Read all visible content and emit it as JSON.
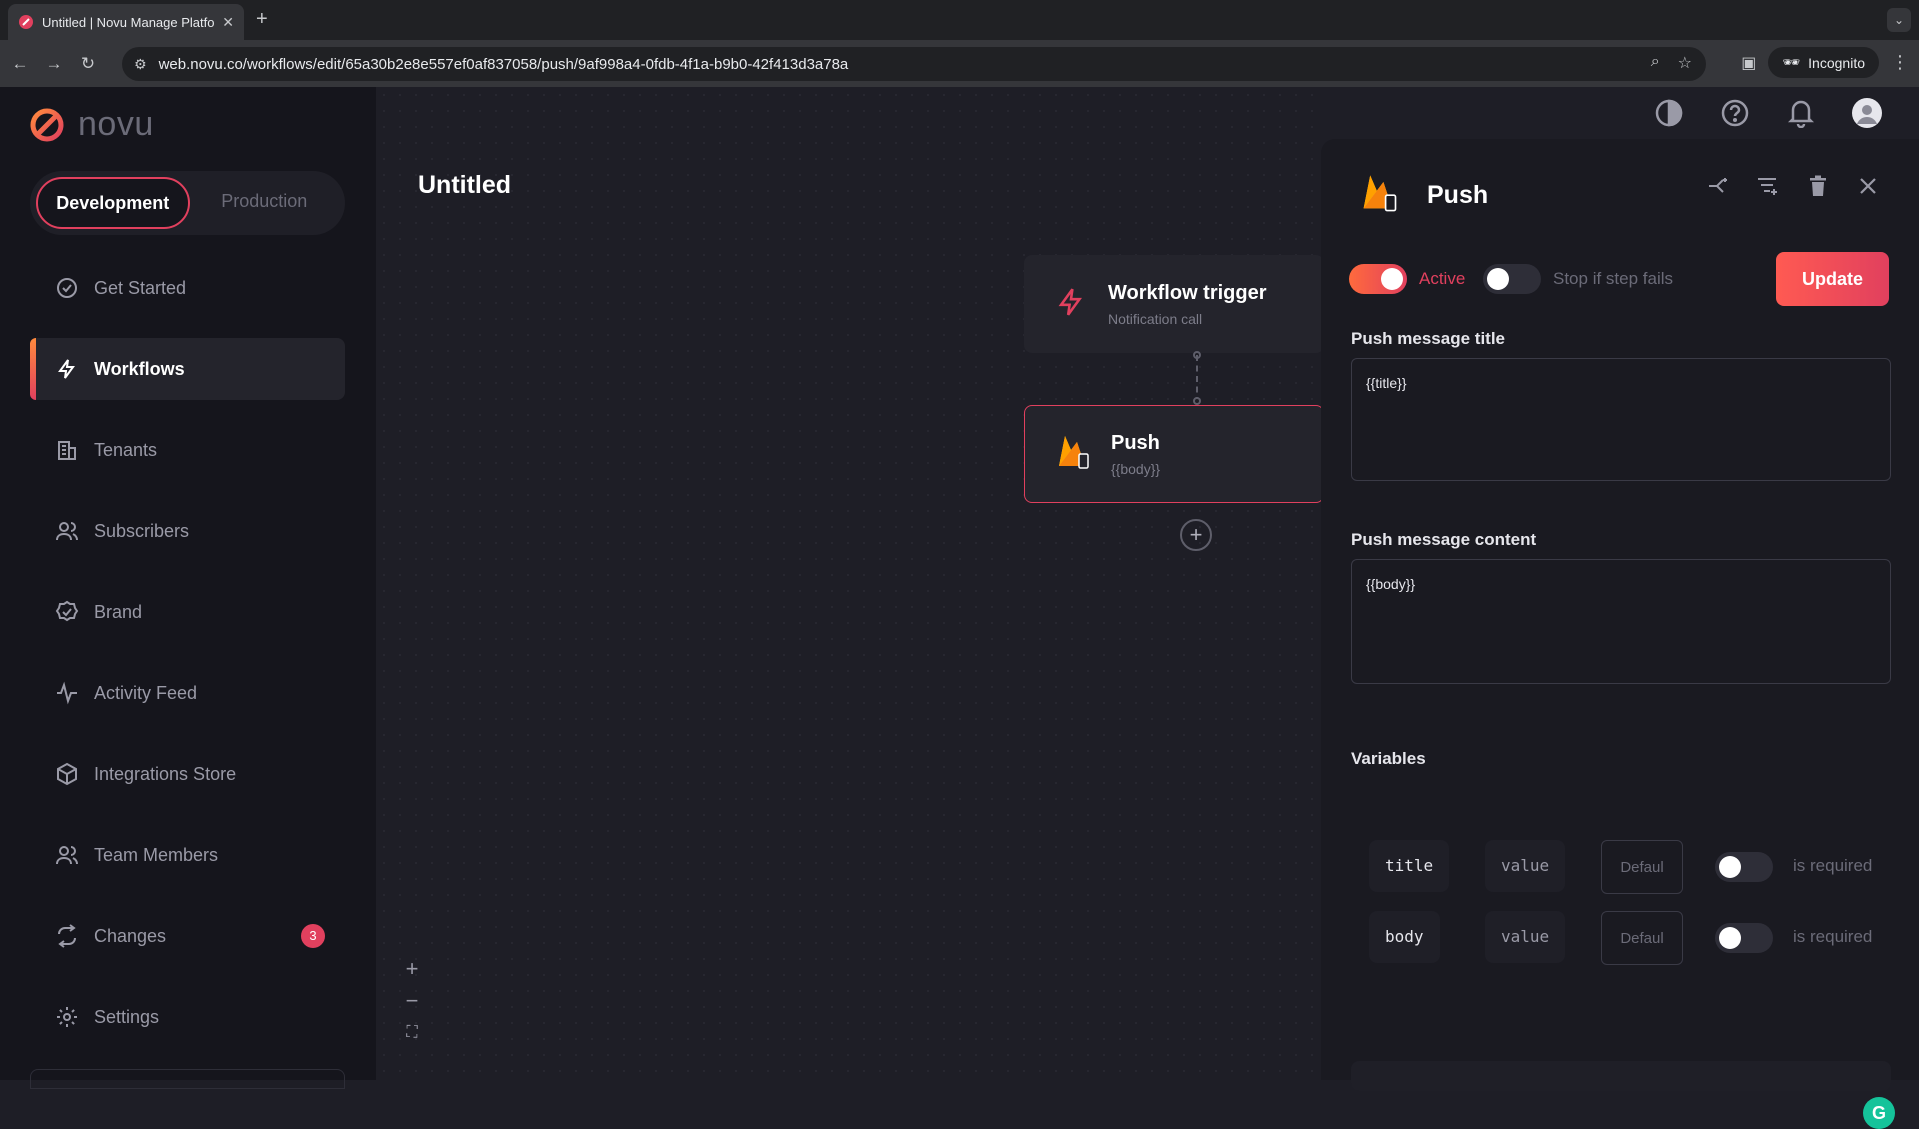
{
  "browser": {
    "tab_title": "Untitled | Novu Manage Platfo",
    "url": "web.novu.co/workflows/edit/65a30b2e8e557ef0af837058/push/9af998a4-0fdb-4f1a-b9b0-42f413d3a78a",
    "incognito_label": "Incognito"
  },
  "app": {
    "logo_text": "novu",
    "env": {
      "development": "Development",
      "production": "Production"
    },
    "nav": [
      {
        "label": "Get Started",
        "icon": "check-circle-icon"
      },
      {
        "label": "Workflows",
        "icon": "bolt-icon"
      },
      {
        "label": "Tenants",
        "icon": "building-icon"
      },
      {
        "label": "Subscribers",
        "icon": "users-icon"
      },
      {
        "label": "Brand",
        "icon": "badge-check-icon"
      },
      {
        "label": "Activity Feed",
        "icon": "activity-icon"
      },
      {
        "label": "Integrations Store",
        "icon": "box-icon"
      },
      {
        "label": "Team Members",
        "icon": "users-icon"
      },
      {
        "label": "Changes",
        "icon": "repeat-icon",
        "badge": "3"
      },
      {
        "label": "Settings",
        "icon": "gear-icon"
      }
    ]
  },
  "workflow": {
    "title": "Untitled",
    "trigger": {
      "title": "Workflow trigger",
      "subtitle": "Notification call"
    },
    "step": {
      "title": "Push",
      "subtitle": "{{body}}"
    }
  },
  "panel": {
    "title": "Push",
    "active_label": "Active",
    "active_on": true,
    "stop_label": "Stop if step fails",
    "stop_on": false,
    "update_label": "Update",
    "title_field": {
      "label": "Push message title",
      "value": "{{title}}"
    },
    "content_field": {
      "label": "Push message content",
      "value": "{{body}}"
    },
    "variables_label": "Variables",
    "variables": [
      {
        "name": "title",
        "type": "value",
        "default_placeholder": "Defaul",
        "required_label": "is required"
      },
      {
        "name": "body",
        "type": "value",
        "default_placeholder": "Defaul",
        "required_label": "is required"
      }
    ]
  },
  "colors": {
    "accent": "#e1405e",
    "accent_orange": "#ff6a3d",
    "sidebar_bg": "#15151c",
    "canvas_bg": "#1e1e26"
  }
}
